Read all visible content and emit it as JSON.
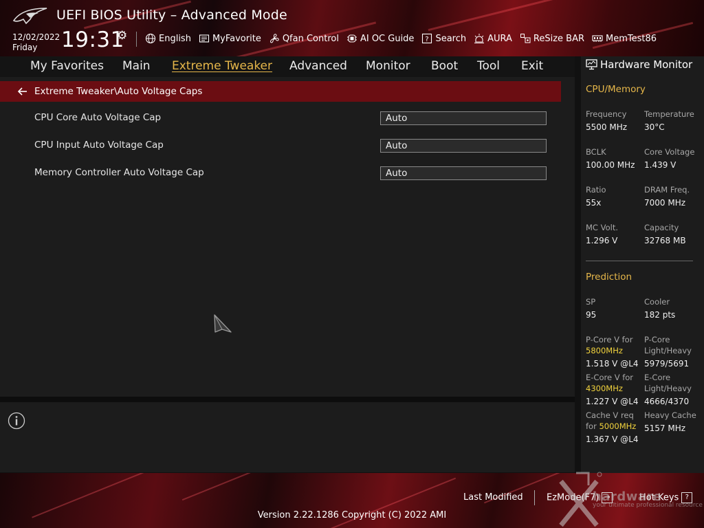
{
  "window": {
    "title": "UEFI BIOS Utility – Advanced Mode"
  },
  "datetime": {
    "date": "12/02/2022",
    "day": "Friday",
    "time": "19:31"
  },
  "toolbar": {
    "items": [
      {
        "label": "English",
        "icon": "globe-icon"
      },
      {
        "label": "MyFavorite",
        "icon": "favorite-icon"
      },
      {
        "label": "Qfan Control",
        "icon": "fan-icon"
      },
      {
        "label": "AI OC Guide",
        "icon": "ai-chip-icon"
      },
      {
        "label": "Search",
        "icon": "search-help-icon"
      },
      {
        "label": "AURA",
        "icon": "aura-light-icon"
      },
      {
        "label": "ReSize BAR",
        "icon": "resize-bar-icon"
      },
      {
        "label": "MemTest86",
        "icon": "memory-icon"
      }
    ]
  },
  "menu": {
    "active": "Extreme Tweaker",
    "items": [
      "My Favorites",
      "Main",
      "Extreme Tweaker",
      "Advanced",
      "Monitor",
      "Boot",
      "Tool",
      "Exit"
    ]
  },
  "breadcrumb": {
    "text": "Extreme Tweaker\\Auto Voltage Caps"
  },
  "settings": [
    {
      "label": "CPU Core Auto Voltage Cap",
      "value": "Auto"
    },
    {
      "label": "CPU Input Auto Voltage Cap",
      "value": "Auto"
    },
    {
      "label": "Memory Controller Auto Voltage Cap",
      "value": "Auto"
    }
  ],
  "hardware_monitor": {
    "title": "Hardware Monitor",
    "cpu_memory": {
      "heading": "CPU/Memory",
      "frequency": {
        "label": "Frequency",
        "value": "5500 MHz"
      },
      "temperature": {
        "label": "Temperature",
        "value": "30°C"
      },
      "bclk": {
        "label": "BCLK",
        "value": "100.00 MHz"
      },
      "core_voltage": {
        "label": "Core Voltage",
        "value": "1.439 V"
      },
      "ratio": {
        "label": "Ratio",
        "value": "55x"
      },
      "dram_freq": {
        "label": "DRAM Freq.",
        "value": "7000 MHz"
      },
      "mc_volt": {
        "label": "MC Volt.",
        "value": "1.296 V"
      },
      "capacity": {
        "label": "Capacity",
        "value": "32768 MB"
      }
    },
    "prediction": {
      "heading": "Prediction",
      "sp": {
        "label": "SP",
        "value": "95"
      },
      "cooler": {
        "label": "Cooler",
        "value": "182 pts"
      },
      "pcore_v": {
        "label_line1": "P-Core V for",
        "label_highlight": "5800MHz",
        "value": "1.518 V @L4"
      },
      "pcore_lh": {
        "label_line1": "P-Core",
        "label_line2": "Light/Heavy",
        "value": "5979/5691"
      },
      "ecore_v": {
        "label_line1": "E-Core V for",
        "label_highlight": "4300MHz",
        "value": "1.227 V @L4"
      },
      "ecore_lh": {
        "label_line1": "E-Core",
        "label_line2": "Light/Heavy",
        "value": "4666/4370"
      },
      "cache_v": {
        "label_line1": "Cache V req",
        "label_prefix": "for ",
        "label_highlight": "5000MHz",
        "value": "1.367 V @L4"
      },
      "heavy_cache": {
        "label": "Heavy Cache",
        "value": "5157 MHz"
      }
    }
  },
  "footer": {
    "last_modified": "Last Modified",
    "ezmode": "EzMode(F7)",
    "ezmode_icon": "→",
    "hotkeys": "Hot Keys",
    "hotkeys_icon": "?",
    "version": "Version 2.22.1286 Copyright (C) 2022 AMI"
  },
  "watermark": {
    "text": "hardware",
    "subtext": "your ultimate professional resource"
  },
  "colors": {
    "accent_gold": "#e6b74a",
    "breadcrumb_red": "#6b0d12",
    "highlight_yellow": "#f2d33d"
  }
}
